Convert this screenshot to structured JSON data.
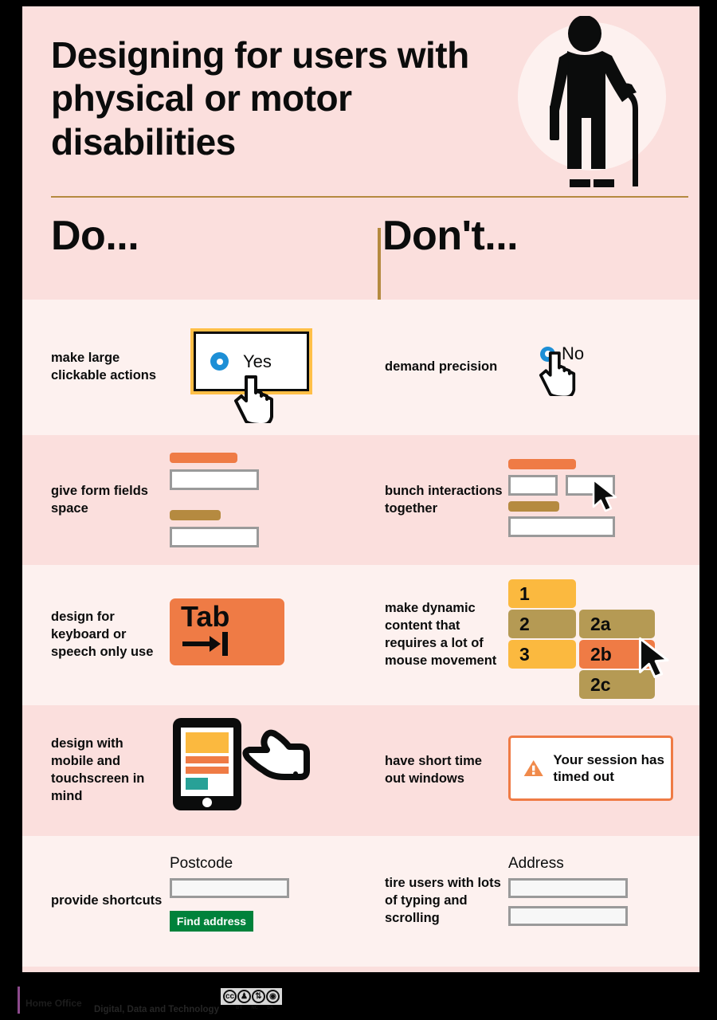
{
  "poster": {
    "title": "Designing for users with physical or motor disabilities",
    "hero_icon": "person-with-walking-cane-icon",
    "columns": {
      "do": "Do...",
      "dont": "Don't..."
    }
  },
  "rows": [
    {
      "do": {
        "label": "make large clickable actions",
        "radio_label": "Yes",
        "cursor_icon": "pointing-hand-cursor-icon"
      },
      "dont": {
        "label": "demand precision",
        "radio_label": "No",
        "cursor_icon": "pointing-hand-cursor-icon"
      }
    },
    {
      "do": {
        "label": "give form fields space"
      },
      "dont": {
        "label": "bunch interactions together",
        "cursor_icon": "arrow-cursor-icon"
      }
    },
    {
      "do": {
        "label": "design for keyboard or speech only use",
        "key_label": "Tab",
        "key_glyph": "tab-arrow-icon"
      },
      "dont": {
        "label": "make dynamic content that requires a lot of mouse movement",
        "menu_main": [
          "1",
          "2",
          "3"
        ],
        "menu_sub": [
          "2a",
          "2b",
          "2c"
        ],
        "cursor_icon": "arrow-cursor-icon"
      }
    },
    {
      "do": {
        "label": "design with mobile and touchscreen in mind",
        "art_icon": "tablet-with-pointing-hand-icon"
      },
      "dont": {
        "label": "have short time out windows",
        "alert_icon": "warning-triangle-icon",
        "alert_text": "Your session has timed out"
      }
    },
    {
      "do": {
        "label": "provide shortcuts",
        "field_label": "Postcode",
        "button_label": "Find address"
      },
      "dont": {
        "label": "tire users with lots of typing and scrolling",
        "field_label": "Address"
      }
    }
  ],
  "footer": {
    "logo_text_line1": "Home",
    "logo_text_line2": "Office",
    "department": "Digital, Data and Technology",
    "license_icon": "creative-commons-badge-icon",
    "license_terms": [
      "BY",
      "NC",
      "SA"
    ]
  },
  "colors": {
    "panel_light": "#fdf1ef",
    "panel_deep": "#fbdfdd",
    "gold": "#b58a40",
    "orange": "#ef7b45",
    "yellow": "#fbb93f",
    "teal": "#28a197",
    "blue": "#1d8fd6",
    "green": "#00823b",
    "focus": "#ffbf47",
    "black": "#0b0c0c"
  }
}
